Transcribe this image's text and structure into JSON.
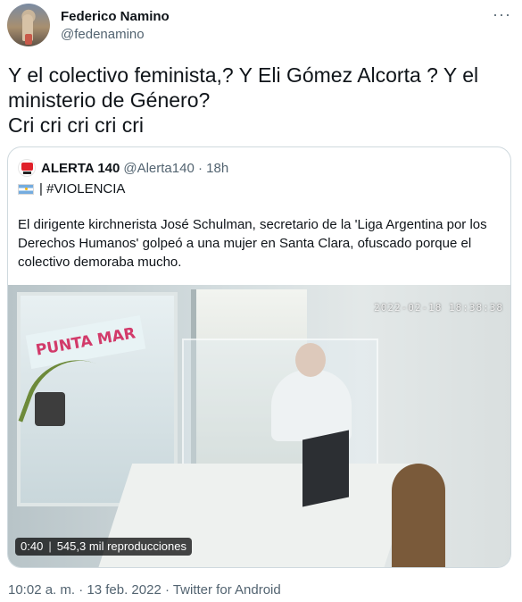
{
  "author": {
    "name": "Federico Namino",
    "handle": "@fedenamino"
  },
  "more_icon": "ellipsis-icon",
  "tweet": {
    "text": "Y el colectivo feminista,? Y Eli Gómez Alcorta ? Y el ministerio de Género?\nCri cri cri cri cri"
  },
  "quote": {
    "name": "ALERTA 140",
    "handle_time": "@Alerta140 · 18h",
    "tag": "| #VIOLENCIA",
    "flag_icon": "argentina-flag-icon",
    "body": "El dirigente kirchnerista José Schulman, secretario de la 'Liga Argentina por los Derechos Humanos' golpeó a una mujer en Santa Clara, ofuscado porque el colectivo demoraba mucho.",
    "video": {
      "timestamp_overlay": "2022-02-18 18:38:38",
      "sign_text": "PUNTA MAR",
      "duration": "0:40",
      "views": "545,3 mil reproducciones"
    }
  },
  "meta": "10:02 a. m. · 13 feb. 2022 · Twitter for Android"
}
